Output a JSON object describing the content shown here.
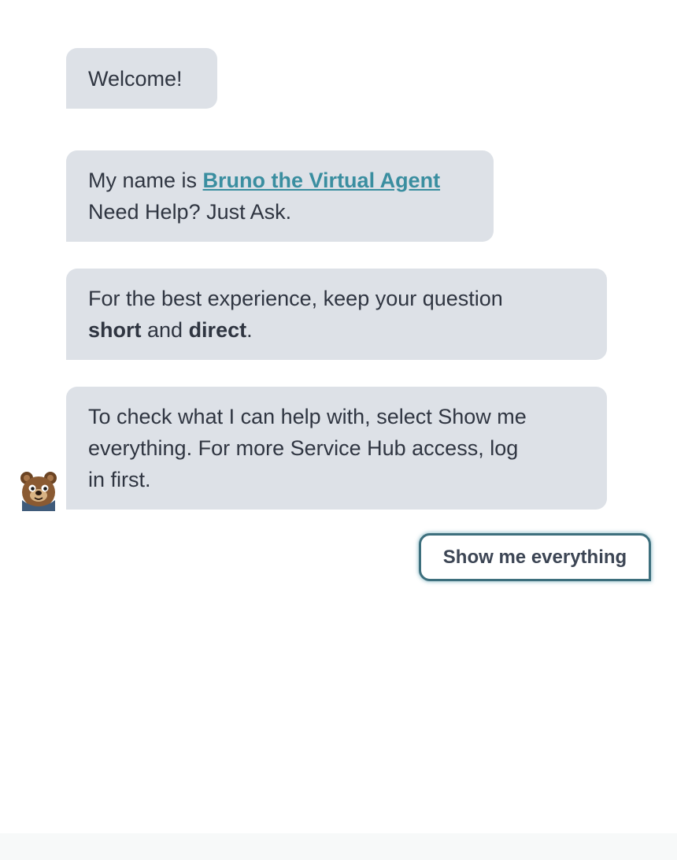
{
  "chat": {
    "messages": [
      {
        "text": "Welcome!"
      },
      {
        "text_before": "My name is ",
        "link_text": "Bruno the Virtual Agent",
        "line2": "Need Help? Just Ask."
      },
      {
        "line1": "For the best experience, keep your question",
        "bold1": "short",
        "mid": " and ",
        "bold2": "direct",
        "end": "."
      },
      {
        "line1": "To check what I can help with, select Show me",
        "line2": "everything. For more Service Hub access, log",
        "line3": "in first."
      }
    ],
    "quick_reply": "Show me everything",
    "avatar_icon": "bear-mascot-avatar"
  },
  "colors": {
    "bubble_bg": "#dde1e7",
    "link": "#3a8ea0",
    "button_border": "#3d6f7d"
  }
}
